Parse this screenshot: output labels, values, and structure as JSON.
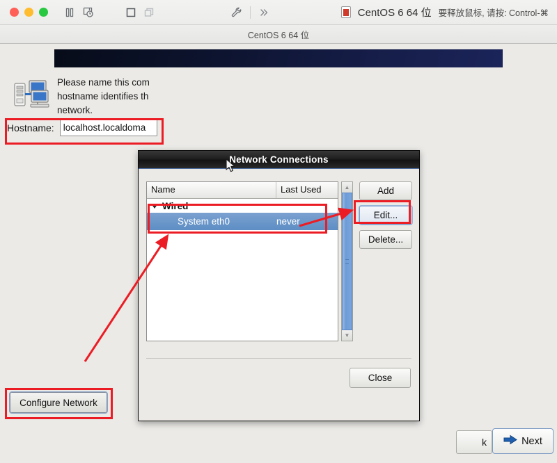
{
  "vm_toolbar": {
    "traffic_lights": [
      "close-red",
      "minimize-yellow",
      "zoom-green"
    ],
    "icons": [
      "pause-icon",
      "snapshot-clock-icon",
      "fullscreen-icon",
      "unity-windows-icon",
      "settings-wrench-icon",
      "chevron-double-right-icon"
    ],
    "os_name": "CentOS 6 64 位",
    "release_hint": "要释放鼠标, 请按: Control-⌘"
  },
  "vm_tab": {
    "label": "CentOS 6 64 位"
  },
  "installer": {
    "description": "Please name this com\nhostname identifies th\nnetwork.",
    "hostname_label": "Hostname:",
    "hostname_value": "localhost.localdoma",
    "configure_network_label": "Configure Network",
    "back_label": "k",
    "next_label": "Next"
  },
  "dialog": {
    "title": "Network Connections",
    "columns": [
      "Name",
      "Last Used"
    ],
    "groups": [
      {
        "name": "Wired",
        "expanded": true,
        "rows": [
          {
            "name": "System eth0",
            "last_used": "never",
            "selected": true
          }
        ]
      }
    ],
    "buttons": {
      "add": "Add",
      "edit": "Edit...",
      "delete": "Delete...",
      "close": "Close"
    }
  },
  "colors": {
    "annotation_red": "#ec1c24",
    "selection_blue": "#5d8ec4",
    "banner_navy": "#151d48"
  }
}
